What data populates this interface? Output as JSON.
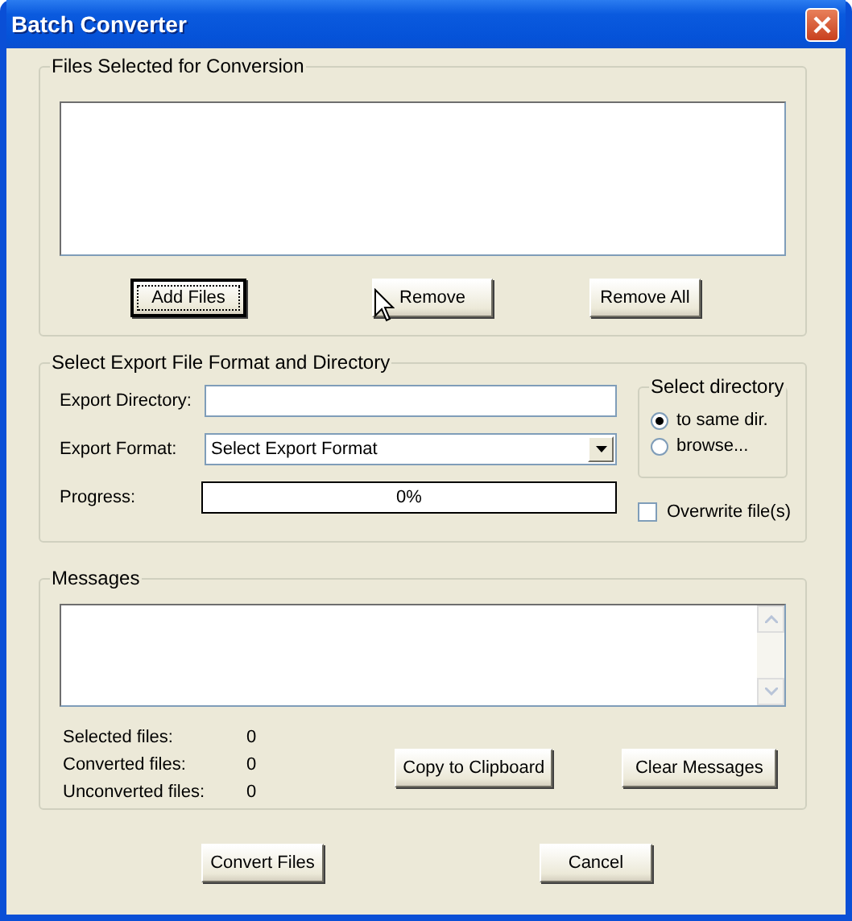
{
  "window": {
    "title": "Batch Converter"
  },
  "files_group": {
    "title": "Files Selected for Conversion",
    "buttons": [
      {
        "label": "Add Files",
        "focused": true
      },
      {
        "label": "Remove",
        "focused": false
      },
      {
        "label": "Remove All",
        "focused": false
      }
    ]
  },
  "export_group": {
    "title": "Select Export File Format and Directory",
    "directory_label": "Export Directory:",
    "format_label": "Export Format:",
    "format_value": "Select Export Format",
    "progress_label": "Progress:",
    "progress": {
      "level": 0,
      "reading": "0%"
    },
    "directory_box": {
      "title": "Select directory",
      "options": [
        {
          "label": "to same dir.",
          "selected": true
        },
        {
          "label": "browse...",
          "selected": false
        }
      ]
    },
    "overwrite": {
      "label": "Overwrite file(s)",
      "checked": false
    }
  },
  "messages_group": {
    "title": "Messages",
    "stats": [
      {
        "label": "Selected files:",
        "value": "0"
      },
      {
        "label": "Converted files:",
        "value": "0"
      },
      {
        "label": "Unconverted files:",
        "value": "0"
      }
    ],
    "buttons": [
      "Copy to Clipboard",
      "Clear Messages"
    ]
  },
  "buttons": [
    "Convert Files",
    "Cancel"
  ]
}
